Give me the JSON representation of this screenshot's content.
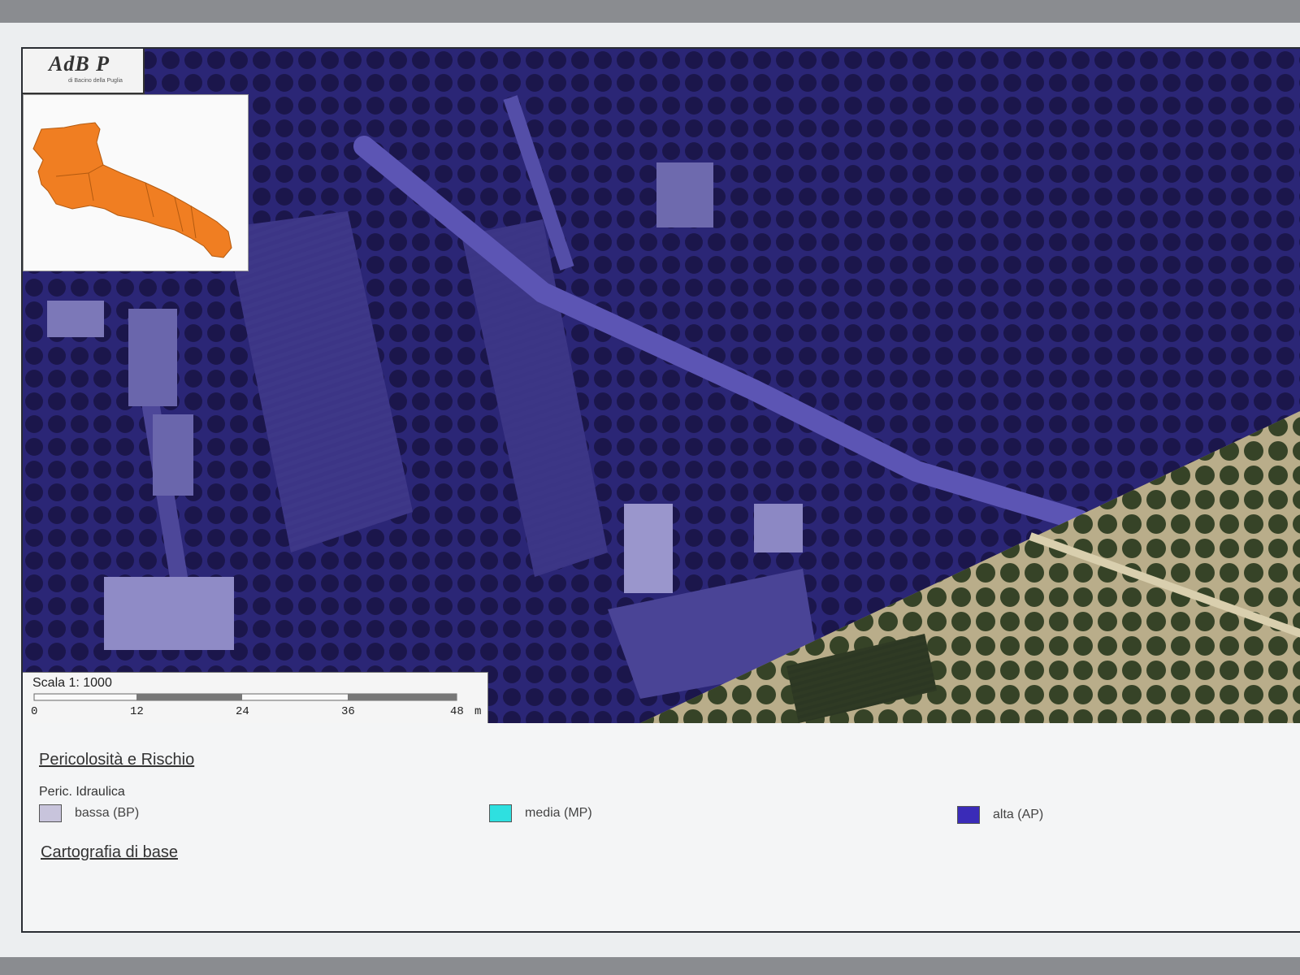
{
  "logo": {
    "text": "AdB P",
    "subtext": "di Bacino della Puglia"
  },
  "inset": {
    "region_icon": "puglia-region-map-icon",
    "region_color": "#f07e22"
  },
  "scale": {
    "title": "Scala 1: 1000",
    "ticks": [
      "0",
      "12",
      "24",
      "36",
      "48"
    ],
    "unit": "m"
  },
  "legend": {
    "heading": "Pericolosità e Rischio",
    "subheading": "Peric. Idraulica",
    "items": [
      {
        "label": "bassa (BP)",
        "color": "#c8c4dc"
      },
      {
        "label": "media (MP)",
        "color": "#2ee0e0"
      },
      {
        "label": "alta (AP)",
        "color": "#3a2bb8"
      }
    ],
    "base_heading": "Cartografia di base"
  },
  "colors": {
    "hazard_overlay": "#3a2bb8",
    "vegetation": "#3d4a2e",
    "ground": "#b9ad8a"
  }
}
